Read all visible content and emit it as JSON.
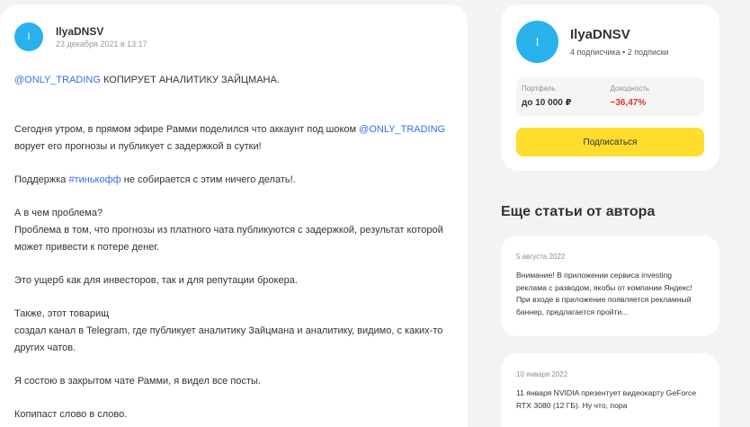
{
  "post": {
    "avatar_letter": "I",
    "author": "IlyaDNSV",
    "date": "23 декабря 2021 в 13:17",
    "p1_link": "@ONLY_TRADING",
    "p1_text": " КОПИРУЕТ АНАЛИТИКУ ЗАЙЦМАНА.",
    "p2_text": "Сегодня утром, в прямом эфире Рамми поделился что аккаунт под шоком ",
    "p2_link": "@ONLY_TRADING",
    "p2_text2": "ворует его прогнозы и публикует с задержкой в сутки!",
    "p3_pre": "Поддержка ",
    "p3_link": "#тинькофф",
    "p3_text": " не собирается с этим ничего делать!.",
    "p4_line1": "А в чем проблема?",
    "p4_line2": "Проблема в том, что прогнозы из платного чата публикуются с задержкой, результат которой может привести к потере денег.",
    "p5_text": "Это ущерб как для инвесторов, так и для репутации брокера.",
    "p6_line1": "Также, этот товарищ",
    "p6_line2": "создал канал в Telegram, где  публикует аналитику Зайцмана и аналитику, видимо, с каких-то других чатов.",
    "p7_text": "Я состою в закрытом чате Рамми, я видел все посты.",
    "p8_text": "Копипаст слово в слово."
  },
  "profile": {
    "avatar_letter": "I",
    "name": "IlyaDNSV",
    "subs": "4 подписчика • 2 подписки",
    "portfolio_label": "Портфель",
    "portfolio_value": "до 10 000 ₽",
    "yield_label": "Доходность",
    "yield_value": "−36,47%",
    "subscribe_label": "Подписаться"
  },
  "more": {
    "title": "Еще статьи от автора",
    "articles": [
      {
        "date": "5 августа 2022",
        "text": "Внимание! В приложении сервиса investing реклама с разводом, якобы от компании Яндекс! При входе в приложение появляется рекламный баннер, предлагается пройти..."
      },
      {
        "date": "10 января 2022",
        "text": "11 января NVIDIA презентует видеокарту GeForce RTX 3080 (12 ГБ). Ну что, пора"
      }
    ]
  },
  "colors": {
    "link": "#336fee",
    "avatar": "#28b1ea",
    "subscribe_bg": "#ffdd2d",
    "negative": "#e0322f"
  }
}
